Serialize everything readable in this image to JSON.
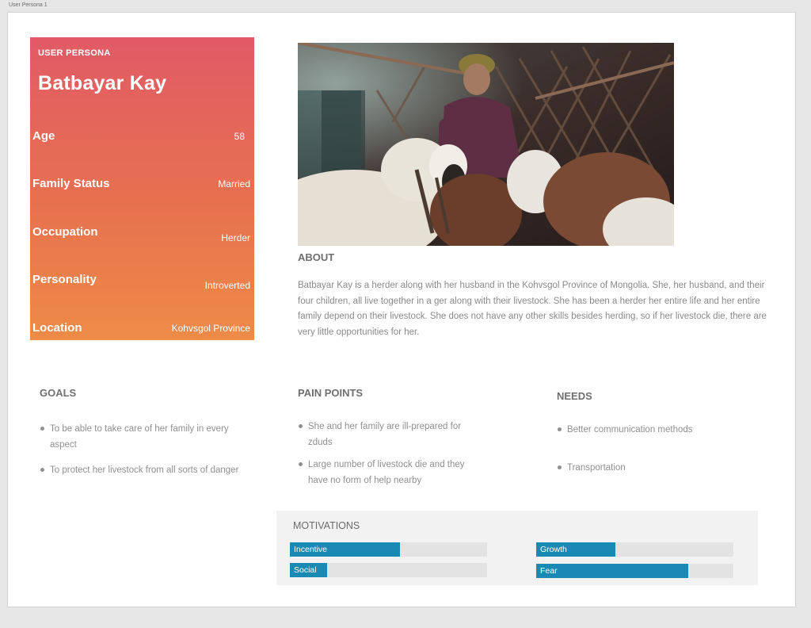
{
  "frame": {
    "title": "User Persona 1"
  },
  "persona": {
    "eyebrow": "USER PERSONA",
    "name": "Batbayar Kay",
    "gradient": [
      "#e15a66",
      "#ee8b47"
    ],
    "attributes": [
      {
        "label": "Age",
        "value": "58"
      },
      {
        "label": "Family Status",
        "value": "Married"
      },
      {
        "label": "Occupation",
        "value": "Herder"
      },
      {
        "label": "Personality",
        "value": "Introverted"
      },
      {
        "label": "Location",
        "value": "Kohvsgol Province"
      }
    ]
  },
  "photo": {
    "subject": "herder-with-livestock-in-ger-photo"
  },
  "about": {
    "title": "ABOUT",
    "text": "Batbayar Kay is a herder along with her husband in the Kohvsgol Province of Mongolia. She, her husband, and their four children, all live together in a ger along with their livestock. She has been a herder her entire life and her entire family depend on their livestock. She does not have any other skills besides herding, so if her livestock die, there are very little opportunities for her."
  },
  "goals": {
    "title": "GOALS",
    "items": [
      "To be able to take care of her family in every aspect",
      "To protect her livestock from all sorts of danger"
    ]
  },
  "pain_points": {
    "title": "PAIN POINTS",
    "items": [
      "She and her family are ill-prepared for zduds",
      "Large number of livestock die and they have no form of help nearby"
    ]
  },
  "needs": {
    "title": "NEEDS",
    "items": [
      "Better communication methods",
      "Transportation"
    ]
  },
  "motivations": {
    "title": "MOTIVATIONS",
    "bar_color": "#1a8ab5",
    "bars": [
      {
        "label": "Incentive",
        "level": 0.56
      },
      {
        "label": "Growth",
        "level": 0.4
      },
      {
        "label": "Social",
        "level": 0.19
      },
      {
        "label": "Fear",
        "level": 0.77
      }
    ]
  }
}
